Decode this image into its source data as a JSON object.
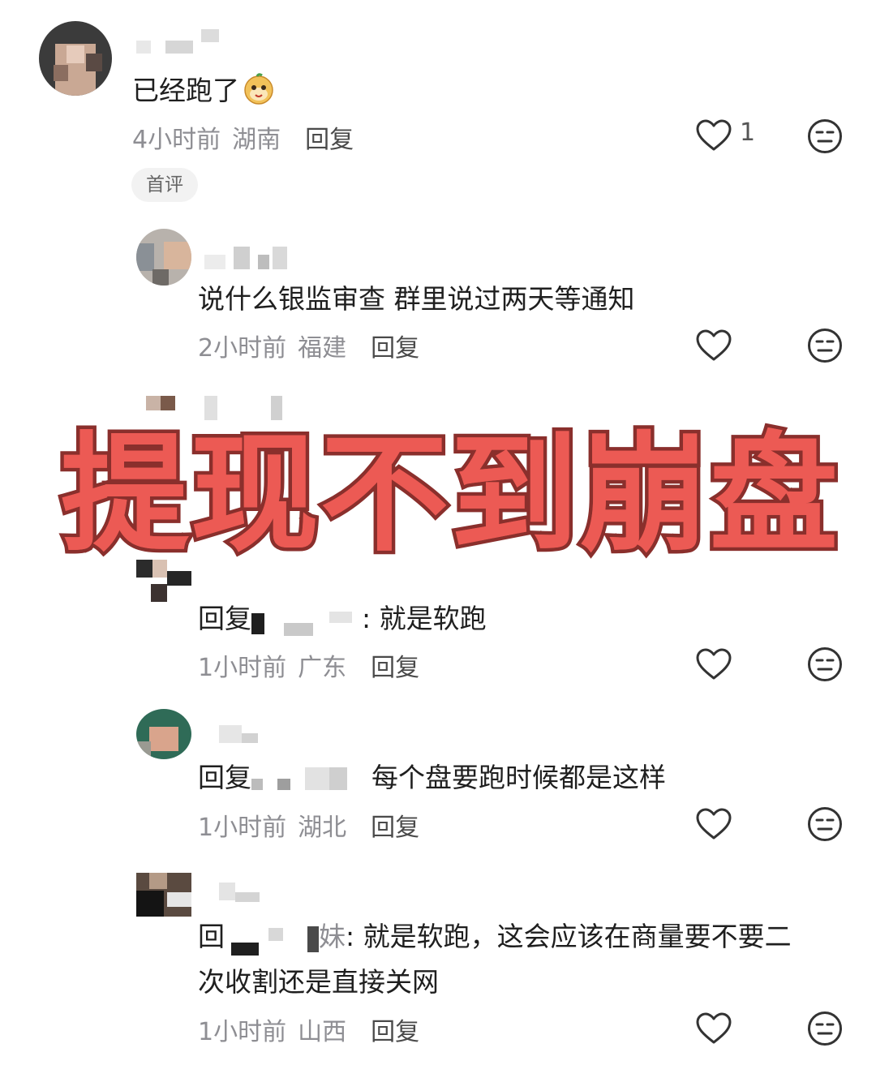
{
  "comments": [
    {
      "text": "已经跑了",
      "time": "4小时前",
      "location": "湖南",
      "reply_label": "回复",
      "likes": "1",
      "badge": "首评"
    },
    {
      "text": "说什么银监审查  群里说过两天等通知",
      "time": "2小时前",
      "location": "福建",
      "reply_label": "回复"
    },
    {
      "text_prefix": "回复",
      "text_suffix": ": 就是软跑",
      "time": "1小时前",
      "location": "广东",
      "reply_label": "回复"
    },
    {
      "text_prefix": "回复",
      "text_suffix": "每个盘要跑时候都是这样",
      "time": "1小时前",
      "location": "湖北",
      "reply_label": "回复"
    },
    {
      "text_prefix": "回",
      "text_middle": "妹",
      "text_suffix": ": 就是软跑，这会应该在商量要不要二",
      "text_line2": "次收割还是直接关网",
      "time": "1小时前",
      "location": "山西",
      "reply_label": "回复"
    }
  ],
  "overlay_title": "提现不到崩盘",
  "icons": {
    "like": "heart-icon",
    "dislike": "neutral-face-icon",
    "emoji": "cartoon-emoji-icon"
  },
  "colors": {
    "overlay_fill": "#ec5a54",
    "overlay_stroke": "#8a2f2c",
    "meta": "#8e8e93"
  }
}
